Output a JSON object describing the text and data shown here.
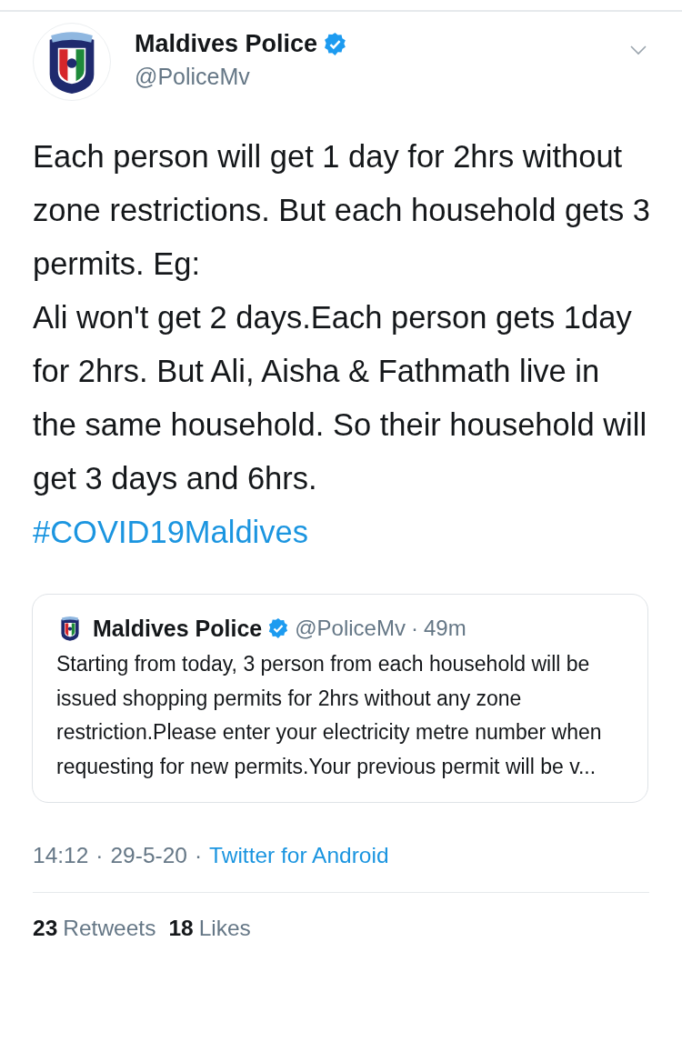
{
  "tweet": {
    "author": {
      "name": "Maldives Police",
      "verified": true,
      "handle": "@PoliceMv"
    },
    "text": "Each person will get 1 day for 2hrs without zone restrictions. But each household gets 3 permits. Eg:\nAli won't get 2 days.Each person gets 1day for 2hrs. But Ali, Aisha & Fathmath live in the same household. So their household will get 3 days and 6hrs.",
    "hashtag": "#COVID19Maldives",
    "quoted": {
      "name": "Maldives Police",
      "verified": true,
      "handle": "@PoliceMv",
      "separator": "·",
      "age": "49m",
      "text": "Starting from today, 3 person from each household will be issued shopping permits for 2hrs without any zone restriction.Please enter your electricity metre number when requesting for new permits.Your previous permit will be v..."
    },
    "time": "14:12",
    "date": "29-5-20",
    "separator": "·",
    "source": "Twitter for Android",
    "stats": [
      {
        "count": "23",
        "label": "Retweets"
      },
      {
        "count": "18",
        "label": "Likes"
      }
    ]
  }
}
